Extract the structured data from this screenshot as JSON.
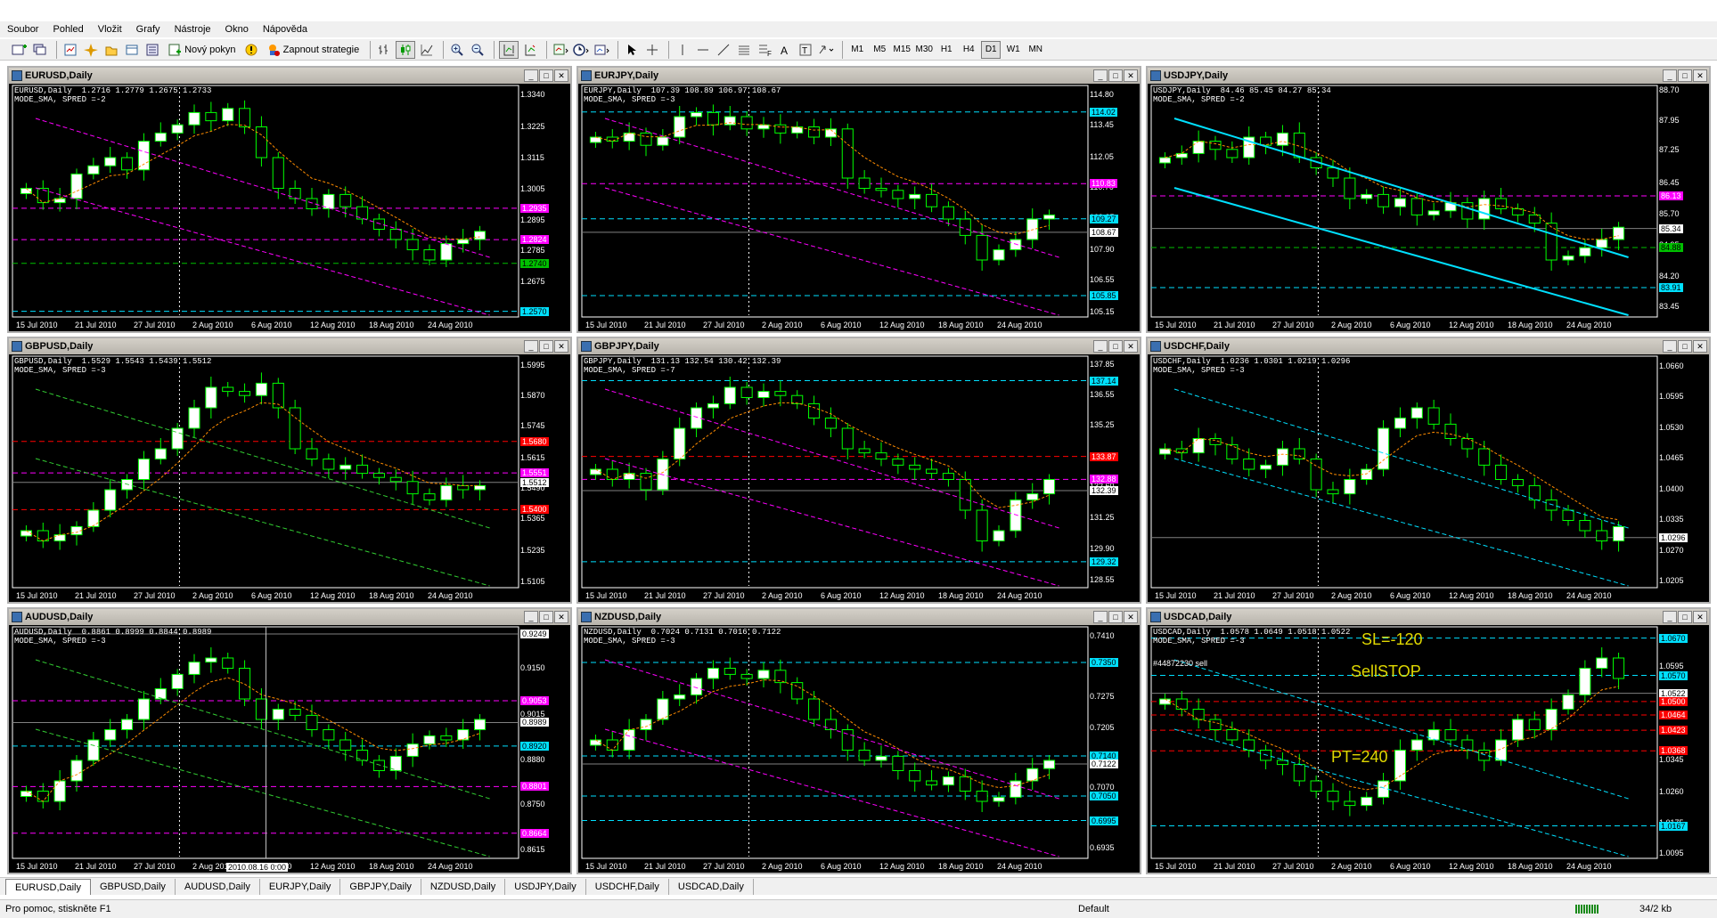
{
  "menu": [
    "Soubor",
    "Pohled",
    "Vložit",
    "Grafy",
    "Nástroje",
    "Okno",
    "Nápověda"
  ],
  "toolbar": {
    "new_order": "Nový pokyn",
    "expert": "Zapnout strategie",
    "timeframes": [
      "M1",
      "M5",
      "M15",
      "M30",
      "H1",
      "H4",
      "D1",
      "W1",
      "MN"
    ],
    "active_timeframe": "D1",
    "icons": [
      "new-chart-icon",
      "profiles-icon",
      "market-watch-icon",
      "navigator-icon",
      "terminal-icon",
      "strategy-tester-icon",
      "new-order-icon",
      "expert-advisors-icon",
      "bar-chart-icon",
      "candlestick-icon",
      "line-chart-icon",
      "zoom-in-icon",
      "zoom-out-icon",
      "chart-shift-icon",
      "autoscroll-icon",
      "indicators-icon",
      "periods-icon",
      "templates-icon",
      "cursor-icon",
      "crosshair-icon",
      "vertical-line-icon",
      "horizontal-line-icon",
      "trendline-icon",
      "channel-icon",
      "fibonacci-icon",
      "text-icon",
      "label-icon",
      "arrows-icon"
    ]
  },
  "colors": {
    "bg": "#000000",
    "bull": "#ffffff",
    "bear": "#000000",
    "wick": "#00ff00",
    "grid": "#ffffff",
    "cyan": "#00e0ff",
    "magenta": "#ff00ff",
    "red": "#ff0000",
    "orange": "#ff8c00",
    "green": "#00c000",
    "lime": "#32cd32",
    "yellow": "#e0d800"
  },
  "windows": [
    {
      "title": "EURUSD,Daily",
      "info1": "EURUSD,Daily  1.2716 1.2779 1.2675 1.2733",
      "info2": "MODE_SMA, SPRED =-2",
      "yticks": [
        "1.3340",
        "1.3225",
        "1.3115",
        "1.3005",
        "1.2895",
        "1.2785",
        "1.2675",
        "1.2570"
      ],
      "labels": [
        {
          "v": "1.2935",
          "c": "#ff00ff"
        },
        {
          "v": "1.2824",
          "c": "#ff00ff"
        },
        {
          "v": "1.2740",
          "c": "#00c000"
        },
        {
          "v": "1.2570",
          "c": "#00e0ff"
        }
      ],
      "xticks": [
        "15 Jul 2010",
        "21 Jul 2010",
        "27 Jul 2010",
        "2 Aug 2010",
        "6 Aug 2010",
        "12 Aug 2010",
        "18 Aug 2010",
        "24 Aug 2010"
      ],
      "ylim": [
        1.255,
        1.337
      ]
    },
    {
      "title": "EURJPY,Daily",
      "info1": "EURJPY,Daily  107.39 108.89 106.97 108.67",
      "info2": "MODE_SMA, SPRED =-3",
      "yticks": [
        "114.80",
        "113.45",
        "112.05",
        "110.70",
        "109.35",
        "107.90",
        "106.55",
        "105.15"
      ],
      "labels": [
        {
          "v": "114.02",
          "c": "#00e0ff"
        },
        {
          "v": "110.83",
          "c": "#ff00ff"
        },
        {
          "v": "109.27",
          "c": "#00e0ff"
        },
        {
          "v": "108.67",
          "c": "#ffffff"
        },
        {
          "v": "105.85",
          "c": "#00e0ff"
        }
      ],
      "xticks": [
        "15 Jul 2010",
        "21 Jul 2010",
        "27 Jul 2010",
        "2 Aug 2010",
        "6 Aug 2010",
        "12 Aug 2010",
        "18 Aug 2010",
        "24 Aug 2010"
      ],
      "ylim": [
        104.9,
        115.2
      ]
    },
    {
      "title": "USDJPY,Daily",
      "info1": "USDJPY,Daily  84.46 85.45 84.27 85.34",
      "info2": "MODE_SMA, SPRED =-2",
      "yticks": [
        "88.70",
        "87.95",
        "87.25",
        "86.45",
        "85.70",
        "84.95",
        "84.20",
        "83.45"
      ],
      "labels": [
        {
          "v": "86.13",
          "c": "#ff00ff"
        },
        {
          "v": "85.34",
          "c": "#ffffff"
        },
        {
          "v": "84.88",
          "c": "#00c000"
        },
        {
          "v": "83.91",
          "c": "#00e0ff"
        }
      ],
      "xticks": [
        "15 Jul 2010",
        "21 Jul 2010",
        "27 Jul 2010",
        "2 Aug 2010",
        "6 Aug 2010",
        "12 Aug 2010",
        "18 Aug 2010",
        "24 Aug 2010"
      ],
      "ylim": [
        83.2,
        88.8
      ]
    },
    {
      "title": "GBPUSD,Daily",
      "info1": "GBPUSD,Daily  1.5529 1.5543 1.5439 1.5512",
      "info2": "MODE_SMA, SPRED =-3",
      "yticks": [
        "1.5995",
        "1.5870",
        "1.5745",
        "1.5615",
        "1.5490",
        "1.5365",
        "1.5235",
        "1.5105"
      ],
      "labels": [
        {
          "v": "1.5680",
          "c": "#ff0000"
        },
        {
          "v": "1.5551",
          "c": "#ff00ff"
        },
        {
          "v": "1.5512",
          "c": "#ffffff"
        },
        {
          "v": "1.5400",
          "c": "#ff0000"
        }
      ],
      "xticks": [
        "15 Jul 2010",
        "21 Jul 2010",
        "27 Jul 2010",
        "2 Aug 2010",
        "6 Aug 2010",
        "12 Aug 2010",
        "18 Aug 2010",
        "24 Aug 2010"
      ],
      "ylim": [
        1.508,
        1.603
      ]
    },
    {
      "title": "GBPJPY,Daily",
      "info1": "GBPJPY,Daily  131.13 132.54 130.42 132.39",
      "info2": "MODE_SMA, SPRED =-7",
      "yticks": [
        "137.85",
        "136.55",
        "135.25",
        "133.90",
        "132.60",
        "131.25",
        "129.90",
        "128.55"
      ],
      "labels": [
        {
          "v": "137.14",
          "c": "#00e0ff"
        },
        {
          "v": "133.87",
          "c": "#ff0000"
        },
        {
          "v": "132.88",
          "c": "#ff00ff"
        },
        {
          "v": "132.39",
          "c": "#ffffff"
        },
        {
          "v": "129.32",
          "c": "#00e0ff"
        }
      ],
      "xticks": [
        "15 Jul 2010",
        "21 Jul 2010",
        "27 Jul 2010",
        "2 Aug 2010",
        "6 Aug 2010",
        "12 Aug 2010",
        "18 Aug 2010",
        "24 Aug 2010"
      ],
      "ylim": [
        128.2,
        138.2
      ]
    },
    {
      "title": "USDCHF,Daily",
      "info1": "USDCHF,Daily  1.0236 1.0301 1.0219 1.0296",
      "info2": "MODE_SMA, SPRED =-3",
      "yticks": [
        "1.0660",
        "1.0595",
        "1.0530",
        "1.0465",
        "1.0400",
        "1.0335",
        "1.0270",
        "1.0205"
      ],
      "labels": [
        {
          "v": "1.0296",
          "c": "#ffffff"
        }
      ],
      "xticks": [
        "15 Jul 2010",
        "21 Jul 2010",
        "27 Jul 2010",
        "2 Aug 2010",
        "6 Aug 2010",
        "12 Aug 2010",
        "18 Aug 2010",
        "24 Aug 2010"
      ],
      "ylim": [
        1.019,
        1.068
      ]
    },
    {
      "title": "AUDUSD,Daily",
      "info1": "AUDUSD,Daily  0.8861 0.8999 0.8844 0.8989",
      "info2": "MODE_SMA, SPRED =-3",
      "yticks": [
        "0.9249",
        "0.9150",
        "0.9015",
        "0.8880",
        "0.8750",
        "0.8615"
      ],
      "labels": [
        {
          "v": "0.9249",
          "c": "#ffffff"
        },
        {
          "v": "0.9053",
          "c": "#ff00ff"
        },
        {
          "v": "0.8989",
          "c": "#ffffff"
        },
        {
          "v": "0.8920",
          "c": "#00e0ff"
        },
        {
          "v": "0.8801",
          "c": "#ff00ff"
        },
        {
          "v": "0.8664",
          "c": "#ff00ff"
        }
      ],
      "xticks": [
        "15 Jul 2010",
        "21 Jul 2010",
        "27 Jul 2010",
        "2 Aug 2010",
        "6 Aug 2010",
        "12 Aug 2010",
        "18 Aug 2010",
        "24 Aug 2010"
      ],
      "crosshair": "2010.08.16 0:00",
      "ylim": [
        0.859,
        0.927
      ]
    },
    {
      "title": "NZDUSD,Daily",
      "info1": "NZDUSD,Daily  0.7024 0.7131 0.7016 0.7122",
      "info2": "MODE_SMA, SPRED =-3",
      "yticks": [
        "0.7410",
        "0.7275",
        "0.7205",
        "0.7070",
        "0.6935"
      ],
      "labels": [
        {
          "v": "0.7350",
          "c": "#00e0ff"
        },
        {
          "v": "0.7140",
          "c": "#00e0ff"
        },
        {
          "v": "0.7122",
          "c": "#ffffff"
        },
        {
          "v": "0.7050",
          "c": "#00e0ff"
        },
        {
          "v": "0.6995",
          "c": "#00e0ff"
        }
      ],
      "xticks": [
        "15 Jul 2010",
        "21 Jul 2010",
        "27 Jul 2010",
        "2 Aug 2010",
        "6 Aug 2010",
        "12 Aug 2010",
        "18 Aug 2010",
        "24 Aug 2010"
      ],
      "ylim": [
        0.691,
        0.743
      ]
    },
    {
      "title": "USDCAD,Daily",
      "info1": "USDCAD,Daily  1.0578 1.0649 1.0518 1.0522",
      "info2": "MODE_SMA, SPRED =-3",
      "yticks": [
        "1.0670",
        "1.0595",
        "1.0520",
        "1.0420",
        "1.0345",
        "1.0260",
        "1.0175",
        "1.0095"
      ],
      "labels": [
        {
          "v": "1.0670",
          "c": "#00e0ff"
        },
        {
          "v": "1.0570",
          "c": "#00e0ff"
        },
        {
          "v": "1.0522",
          "c": "#ffffff"
        },
        {
          "v": "1.0500",
          "c": "#ff0000"
        },
        {
          "v": "1.0464",
          "c": "#ff0000"
        },
        {
          "v": "1.0423",
          "c": "#ff0000"
        },
        {
          "v": "1.0368",
          "c": "#ff0000"
        },
        {
          "v": "1.0167",
          "c": "#00e0ff"
        }
      ],
      "xticks": [
        "15 Jul 2010",
        "21 Jul 2010",
        "27 Jul 2010",
        "2 Aug 2010",
        "6 Aug 2010",
        "12 Aug 2010",
        "18 Aug 2010",
        "24 Aug 2010"
      ],
      "order": "#44872230 sell",
      "annotations": [
        "SL=-120",
        "SellSTOP",
        "PT=240"
      ],
      "ylim": [
        1.008,
        1.07
      ]
    }
  ],
  "tabs": [
    "EURUSD,Daily",
    "GBPUSD,Daily",
    "AUDUSD,Daily",
    "EURJPY,Daily",
    "GBPJPY,Daily",
    "NZDUSD,Daily",
    "USDJPY,Daily",
    "USDCHF,Daily",
    "USDCAD,Daily"
  ],
  "active_tab": "EURUSD,Daily",
  "status": {
    "help": "Pro pomoc, stiskněte F1",
    "profile": "Default",
    "traffic": "34/2 kb"
  }
}
